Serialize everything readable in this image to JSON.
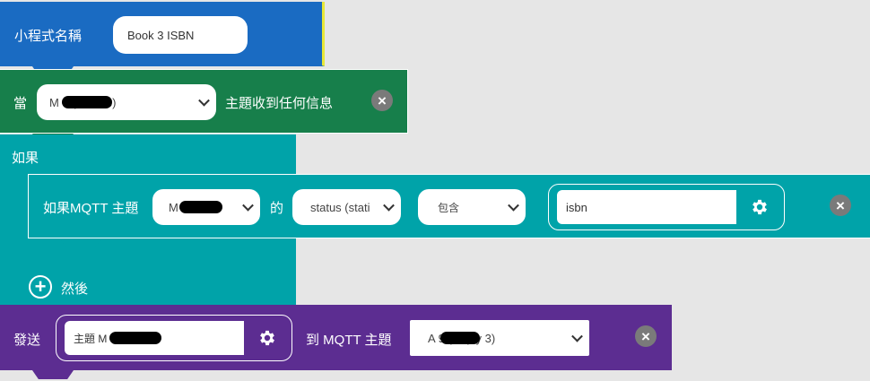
{
  "program_block": {
    "label": "小程式名稱",
    "name_value": "Book 3 ISBN",
    "color": "#1a6bc2",
    "accent": "#e8e838"
  },
  "when_block": {
    "prefix": "當",
    "topic_select": "M        6 (Book 3)",
    "suffix": "主題收到任何信息",
    "color": "#177f4b"
  },
  "if_block": {
    "label": "如果",
    "then_label": "然後",
    "color": "#00a3a9"
  },
  "condition_block": {
    "prefix": "如果MQTT 主題",
    "topic_select": "M        6",
    "of_label": "的",
    "field_select": "status (stati",
    "op_select": "包含",
    "value": "isbn",
    "color": "#00a3a9"
  },
  "send_block": {
    "prefix": "發送",
    "payload_value": "主題 M        6 的 isbn",
    "to_label": "到 MQTT 主題",
    "target_select": "A        9 (Reply 3)",
    "color": "#5c2d91"
  },
  "icons": {
    "close": "close-icon",
    "gear": "gear-icon",
    "chevron": "chevron-down-icon",
    "add": "plus-circle-icon"
  }
}
